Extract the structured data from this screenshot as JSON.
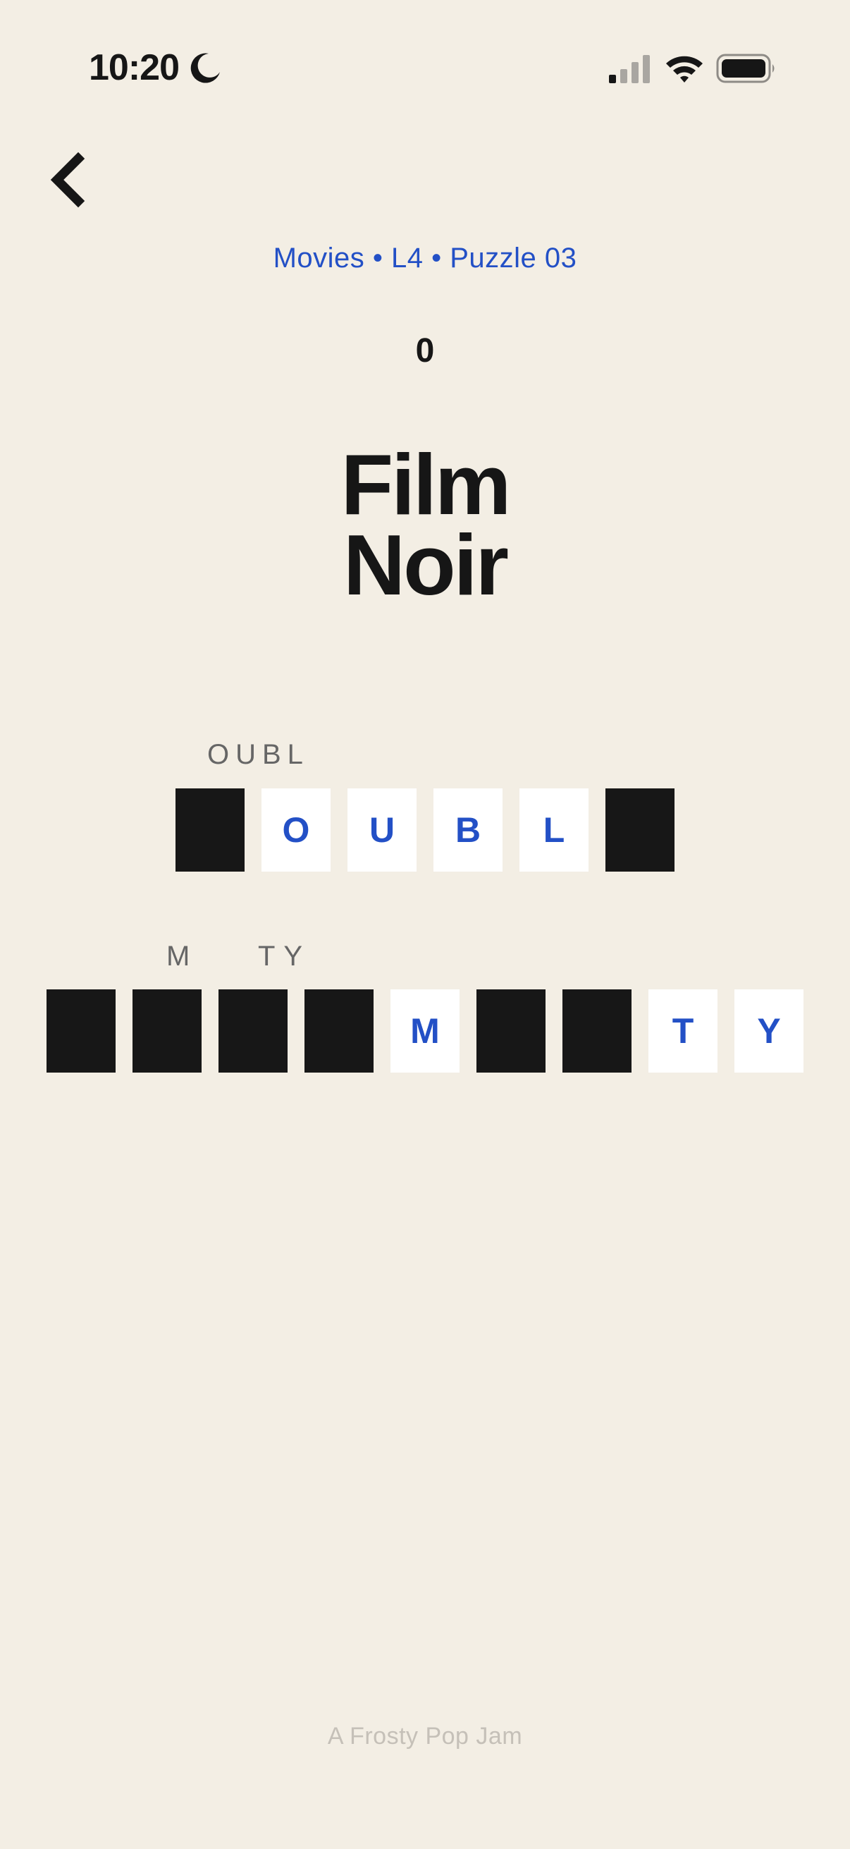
{
  "status_bar": {
    "time": "10:20",
    "icons": [
      "moon-icon",
      "cellular-signal-icon",
      "wifi-icon",
      "battery-icon"
    ]
  },
  "nav": {
    "back_icon": "chevron-left-icon"
  },
  "breadcrumb": "Movies • L4 • Puzzle 03",
  "score": "0",
  "title_line1": "Film",
  "title_line2": "Noir",
  "rows": [
    {
      "hint": "OUBL",
      "tiles": [
        {
          "letter": "",
          "filled": true
        },
        {
          "letter": "O",
          "filled": false
        },
        {
          "letter": "U",
          "filled": false
        },
        {
          "letter": "B",
          "filled": false
        },
        {
          "letter": "L",
          "filled": false
        },
        {
          "letter": "",
          "filled": true
        }
      ]
    },
    {
      "hint_part1": "M",
      "hint_part2": "TY",
      "tiles": [
        {
          "letter": "",
          "filled": true
        },
        {
          "letter": "",
          "filled": true
        },
        {
          "letter": "",
          "filled": true
        },
        {
          "letter": "",
          "filled": true
        },
        {
          "letter": "M",
          "filled": false
        },
        {
          "letter": "",
          "filled": true
        },
        {
          "letter": "",
          "filled": true
        },
        {
          "letter": "T",
          "filled": false
        },
        {
          "letter": "Y",
          "filled": false
        }
      ]
    }
  ],
  "footer": "A Frosty Pop Jam",
  "colors": {
    "background": "#F3EEE4",
    "accent": "#2350C6",
    "ink": "#161616",
    "tile_empty": "#FFFFFF",
    "tile_blocked": "#171717",
    "hint": "#666666",
    "footer": "#C5C0B8"
  }
}
